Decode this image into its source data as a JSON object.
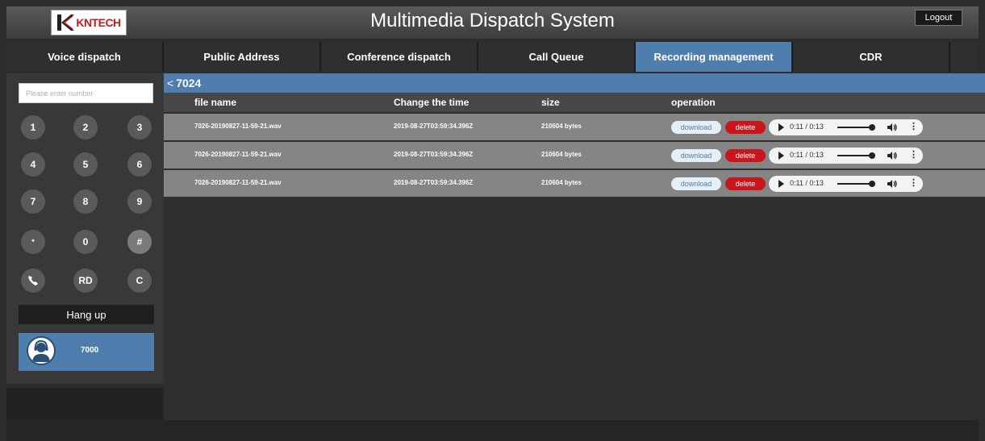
{
  "header": {
    "logo_text": "KNTECH",
    "title": "Multimedia Dispatch System",
    "logout_label": "Logout"
  },
  "nav": {
    "tabs": [
      {
        "label": "Voice dispatch",
        "active": false
      },
      {
        "label": "Public Address",
        "active": false
      },
      {
        "label": "Conference dispatch",
        "active": false
      },
      {
        "label": "Call Queue",
        "active": false
      },
      {
        "label": "Recording management",
        "active": true
      },
      {
        "label": "CDR",
        "active": false
      }
    ]
  },
  "dialpad": {
    "search_placeholder": "Please enter number",
    "keys": [
      "1",
      "2",
      "3",
      "4",
      "5",
      "6",
      "7",
      "8",
      "9",
      "*",
      "0",
      "#",
      "call-icon",
      "RD",
      "C"
    ],
    "hangup_label": "Hang up",
    "user": {
      "number": "7000",
      "icon": "operator-headset-icon"
    }
  },
  "recordings": {
    "breadcrumb": "7024",
    "columns": {
      "file_name": "file name",
      "change_time": "Change the time",
      "size": "size",
      "operation": "operation"
    },
    "download_label": "download",
    "delete_label": "delete",
    "rows": [
      {
        "file_name": "7026-20190827-11-59-21.wav",
        "change_time": "2019-08-27T03:59:34.396Z",
        "size": "210604 bytes",
        "player_time": "0:11 / 0:13",
        "progress": 0.85
      },
      {
        "file_name": "7026-20190827-11-59-21.wav",
        "change_time": "2019-08-27T03:59:34.396Z",
        "size": "210604 bytes",
        "player_time": "0:11 / 0:13",
        "progress": 0.85
      },
      {
        "file_name": "7026-20190827-11-59-21.wav",
        "change_time": "2019-08-27T03:59:34.396Z",
        "size": "210604 bytes",
        "player_time": "0:11 / 0:13",
        "progress": 0.85
      }
    ]
  },
  "colors": {
    "accent": "#4f7eae",
    "delete": "#c9161c",
    "row_bg": "#858585",
    "brand_red": "#c41b1b"
  }
}
